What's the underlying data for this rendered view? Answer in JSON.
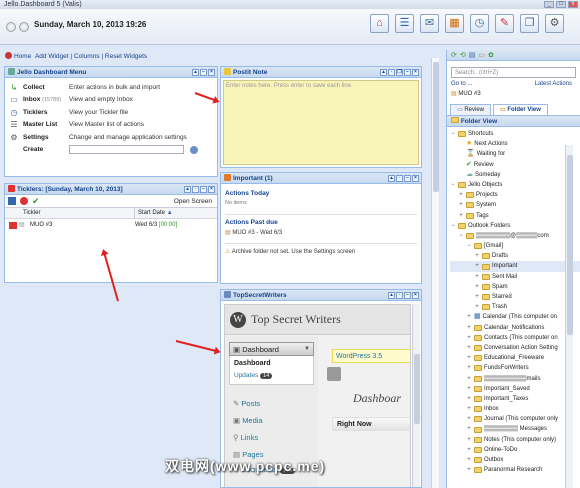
{
  "window": {
    "title": "Jello.Dashboard 5 (Valis)"
  },
  "header": {
    "date": "Sunday, March 10, 2013 19:26"
  },
  "toolbar": {
    "icons": [
      "home-icon",
      "list-icon",
      "inbox-icon",
      "calendar-icon",
      "clock-icon",
      "notes-icon",
      "windows-icon",
      "gear-icon"
    ]
  },
  "menubar": {
    "home": "Home",
    "add_widget": "Add Widget",
    "columns": "Columns",
    "reset_widgets": "Reset Widgets",
    "sep": "|"
  },
  "jello_menu": {
    "title": "Jello Dashboard Menu",
    "items": [
      {
        "label": "Collect",
        "desc": "Enter actions in bulk and import"
      },
      {
        "label": "Inbox",
        "count": "(15789)",
        "desc": "View and empty Inbox"
      },
      {
        "label": "Ticklers",
        "desc": "View your Tickler file"
      },
      {
        "label": "Master List",
        "desc": "View Master list of actions"
      },
      {
        "label": "Settings",
        "desc": "Change and manage application settings"
      }
    ],
    "create_label": "Create"
  },
  "postit": {
    "title": "Postit Note",
    "placeholder": "Enter notes here. Press enter to save each line."
  },
  "ticklers": {
    "title": "Ticklers: [Sunday, March 10, 2013]",
    "open_screen": "Open Screen",
    "col_tickler": "Tickler",
    "col_start": "Start Date",
    "rows": [
      {
        "name": "MUO #3",
        "date": "Wed 6/3",
        "time": "[00:00]"
      }
    ]
  },
  "important": {
    "title": "Important (1)",
    "today_title": "Actions Today",
    "today_empty": "No items",
    "past_title": "Actions Past due",
    "past_item": "MUO #3 - Wed 6/3",
    "warning": "Archive folder not set. Use the Settings screen"
  },
  "topsecret": {
    "title": "TopSecretWriters",
    "site_name": "Top Secret Writers",
    "dashboard_menu": "Dashboard",
    "dashboard_sub": "Dashboard",
    "updates": "Updates",
    "updates_count": "14",
    "wp_update": "WordPress 3.5",
    "heading": "Dashboar",
    "posts": "Posts",
    "media": "Media",
    "links": "Links",
    "pages": "Pages",
    "comments": "Comments",
    "comments_count": "744",
    "right_now": "Right Now"
  },
  "sidebar": {
    "search_placeholder": "Search.. (ctrl+Z)",
    "goto": "Go to ...",
    "latest": "Latest Actions",
    "latest_item": "MUO #3",
    "tab_review": "Review",
    "tab_folder": "Folder View",
    "folder_title": "Folder View",
    "tree": [
      {
        "d": 0,
        "exp": "−",
        "label": "Shortcuts",
        "kind": "folder"
      },
      {
        "d": 1,
        "exp": "",
        "label": "Next Actions",
        "kind": "star"
      },
      {
        "d": 1,
        "exp": "",
        "label": "Waiting for",
        "kind": "hour"
      },
      {
        "d": 1,
        "exp": "",
        "label": "Review",
        "kind": "check"
      },
      {
        "d": 1,
        "exp": "",
        "label": "Someday",
        "kind": "cloud"
      },
      {
        "d": 0,
        "exp": "−",
        "label": "Jello Objects",
        "kind": "folder"
      },
      {
        "d": 1,
        "exp": "+",
        "label": "Projects",
        "kind": "folder"
      },
      {
        "d": 1,
        "exp": "+",
        "label": "System",
        "kind": "folder"
      },
      {
        "d": 1,
        "exp": "+",
        "label": "Tags",
        "kind": "folder"
      },
      {
        "d": 0,
        "exp": "−",
        "label": "Outlook Folders",
        "kind": "folder"
      },
      {
        "d": 1,
        "exp": "−",
        "label": "▒▒▒▒▒▒▒▒@▒▒▒▒▒com",
        "kind": "folder"
      },
      {
        "d": 2,
        "exp": "−",
        "label": "[Gmail]",
        "kind": "folder"
      },
      {
        "d": 3,
        "exp": "+",
        "label": "Drafts",
        "kind": "folder"
      },
      {
        "d": 3,
        "exp": "+",
        "label": "Important",
        "kind": "folder",
        "sel": true
      },
      {
        "d": 3,
        "exp": "+",
        "label": "Sent Mail",
        "kind": "folder"
      },
      {
        "d": 3,
        "exp": "+",
        "label": "Spam",
        "kind": "folder"
      },
      {
        "d": 3,
        "exp": "+",
        "label": "Starred",
        "kind": "folder"
      },
      {
        "d": 3,
        "exp": "+",
        "label": "Trash",
        "kind": "folder"
      },
      {
        "d": 2,
        "exp": "+",
        "label": "Calendar (This computer on",
        "kind": "cal"
      },
      {
        "d": 2,
        "exp": "+",
        "label": "Calendar_Notifications",
        "kind": "folder"
      },
      {
        "d": 2,
        "exp": "+",
        "label": "Contacts (This computer on",
        "kind": "folder"
      },
      {
        "d": 2,
        "exp": "+",
        "label": "Conversation Action Setting",
        "kind": "folder"
      },
      {
        "d": 2,
        "exp": "+",
        "label": "Educational_Freeware",
        "kind": "folder"
      },
      {
        "d": 2,
        "exp": "+",
        "label": "FundsForWriters",
        "kind": "folder"
      },
      {
        "d": 2,
        "exp": "+",
        "label": "▒▒▒▒▒▒▒▒▒▒mails",
        "kind": "folder"
      },
      {
        "d": 2,
        "exp": "+",
        "label": "Important_Saved",
        "kind": "folder"
      },
      {
        "d": 2,
        "exp": "+",
        "label": "Important_Taxes",
        "kind": "folder"
      },
      {
        "d": 2,
        "exp": "+",
        "label": "Inbox",
        "kind": "folder"
      },
      {
        "d": 2,
        "exp": "+",
        "label": "Journal (This computer only",
        "kind": "folder"
      },
      {
        "d": 2,
        "exp": "+",
        "label": "▒▒▒▒▒▒▒▒ Messages",
        "kind": "folder"
      },
      {
        "d": 2,
        "exp": "+",
        "label": "Notes (This computer only)",
        "kind": "folder"
      },
      {
        "d": 2,
        "exp": "+",
        "label": "Online-ToDo",
        "kind": "folder"
      },
      {
        "d": 2,
        "exp": "+",
        "label": "Outbox",
        "kind": "folder"
      },
      {
        "d": 2,
        "exp": "+",
        "label": "Paranormal Research",
        "kind": "folder"
      }
    ]
  },
  "watermark": "双电网(www.pcpc.me)"
}
